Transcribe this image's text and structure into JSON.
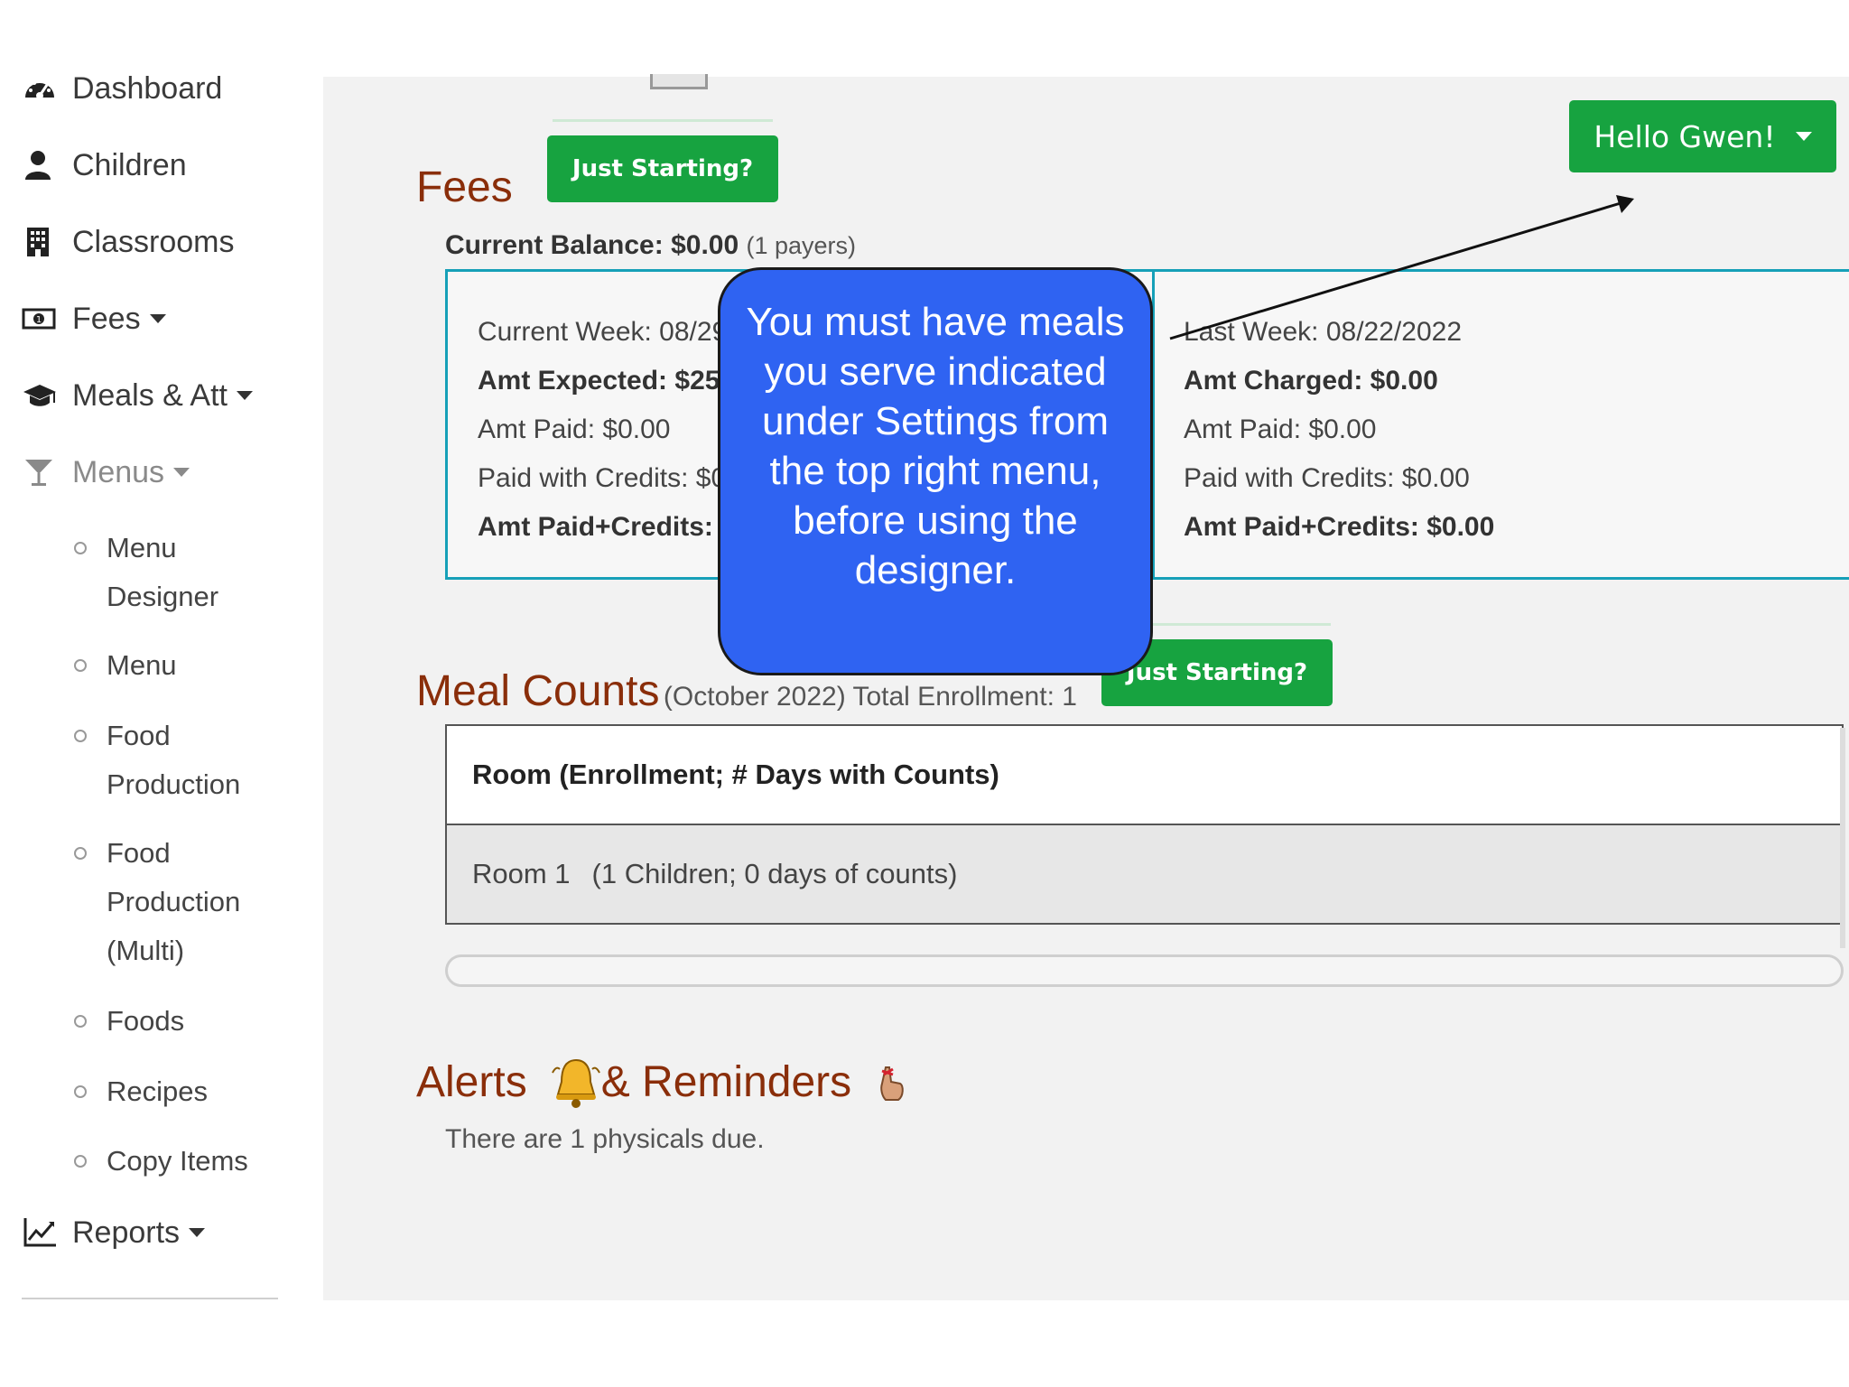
{
  "sidebar": {
    "items": [
      {
        "label": "Dashboard",
        "icon": "dashboard-icon"
      },
      {
        "label": "Children",
        "icon": "user-icon"
      },
      {
        "label": "Classrooms",
        "icon": "building-icon"
      },
      {
        "label": "Fees",
        "icon": "money-icon"
      },
      {
        "label": "Meals & Att",
        "icon": "graduation-cap-icon"
      },
      {
        "label": "Menus",
        "icon": "cocktail-glass-icon"
      }
    ],
    "menus_sub": [
      {
        "line1": "Menu",
        "line2": "Designer",
        "line3": ""
      },
      {
        "line1": "Menu",
        "line2": "",
        "line3": ""
      },
      {
        "line1": "Food",
        "line2": "Production",
        "line3": ""
      },
      {
        "line1": "Food",
        "line2": "Production",
        "line3": "(Multi)"
      },
      {
        "line1": "Foods",
        "line2": "",
        "line3": ""
      },
      {
        "line1": "Recipes",
        "line2": "",
        "line3": ""
      },
      {
        "line1": "Copy Items",
        "line2": "",
        "line3": ""
      }
    ],
    "reports": {
      "label": "Reports",
      "icon": "line-chart-icon"
    }
  },
  "header": {
    "user_button": "Hello Gwen!"
  },
  "fees": {
    "title": "Fees",
    "just_starting": "Just Starting?",
    "balance_label": "Current Balance:",
    "balance_value": "$0.00",
    "payers": "(1 payers)",
    "current_week": {
      "heading": "Current Week: 08/29",
      "expected": "Amt Expected: $25",
      "paid": "Amt Paid: $0.00",
      "credits": "Paid with Credits: $0",
      "total": "Amt Paid+Credits:"
    },
    "last_week": {
      "heading": "Last Week: 08/22/2022",
      "charged": "Amt Charged: $0.00",
      "paid": "Amt Paid: $0.00",
      "credits": "Paid with Credits: $0.00",
      "total": "Amt Paid+Credits: $0.00"
    }
  },
  "meal_counts": {
    "title": "Meal Counts",
    "subtitle": "(October 2022) Total Enrollment: 1",
    "just_starting": "Just Starting?",
    "table_header": "Room (Enrollment; # Days with Counts)",
    "rows": [
      {
        "room": "Room 1",
        "detail": "(1 Children; 0 days of counts)"
      }
    ]
  },
  "alerts": {
    "title_part1": "Alerts",
    "title_part2": "& Reminders",
    "message": "There are 1 physicals due."
  },
  "callout": {
    "text": "You must have meals you serve indicated under Settings from the top right menu, before using the designer."
  },
  "colors": {
    "accent_green": "#17a340",
    "section_title": "#8a2e0a",
    "card_border": "#16a0b8",
    "callout_blue": "#2f63f2"
  }
}
